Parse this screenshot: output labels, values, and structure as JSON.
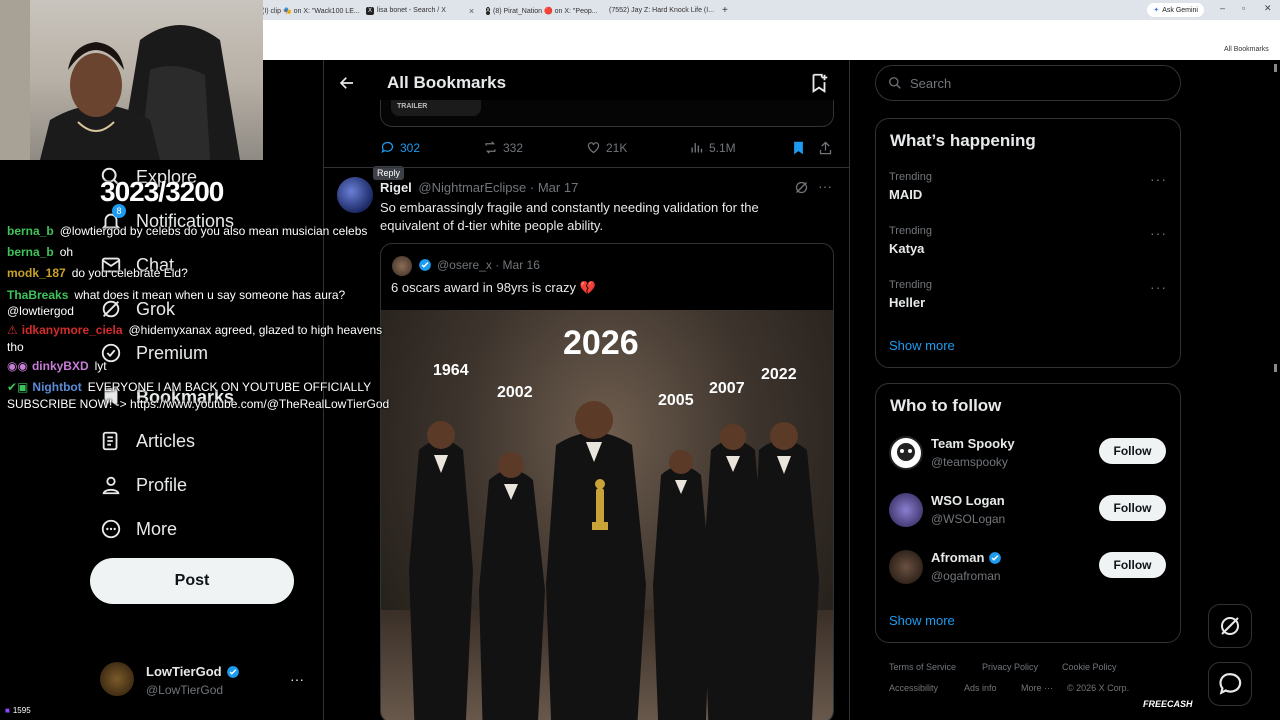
{
  "browser": {
    "tabs": [
      {
        "label": "(I) clip 🎭 on X: \"Wack100 LE..."
      },
      {
        "label": "lisa bonet - Search / X"
      },
      {
        "label": "(8) Pirat_Nation 🔴 on X: \"Peop..."
      },
      {
        "label": "(7552) Jay Z: Hard Knock Life (I..."
      }
    ],
    "new_tab": "+",
    "ask_gemini": "Ask Gemini",
    "all_bookmarks": "All Bookmarks"
  },
  "stream": {
    "counter": "3023/3200",
    "viewers": "1595",
    "watermark": "FREECASH",
    "chat": [
      {
        "user": "berna_b",
        "user_color": "#3ec35a",
        "text": "@lowtiergod by celebs do you also mean musician celebs"
      },
      {
        "user": "berna_b",
        "user_color": "#3ec35a",
        "text": "oh"
      },
      {
        "user": "modk_187",
        "user_color": "#c9a227",
        "text": "do you celebrate Eid?"
      },
      {
        "user": "ThaBreaks",
        "user_color": "#3ec35a",
        "text": "what does it mean when u say someone has aura?"
      },
      {
        "user": "",
        "user_color": "#ffffff",
        "text": "@lowtiergod"
      },
      {
        "user": "idkanymore_ciela",
        "user_color": "#d42b2b",
        "text": "@hidemyxanax agreed, glazed to high heavens"
      },
      {
        "user": "",
        "user_color": "#ffffff",
        "text": "tho"
      },
      {
        "user": "dinkyBXD",
        "user_color": "#c77dd6",
        "text": "lyt"
      },
      {
        "user": "Nightbot",
        "user_color": "#5b8bd6",
        "text": "EVERYONE I AM BACK ON YOUTUBE OFFICIALLY"
      },
      {
        "user": "",
        "user_color": "#ffffff",
        "text": "SUBSCRIBE NOW! -> https://www.youtube.com/@TheRealLowTierGod"
      }
    ]
  },
  "sidebar": {
    "items": [
      {
        "label": "Explore",
        "icon": "search-icon"
      },
      {
        "label": "Notifications",
        "icon": "bell-icon",
        "badge": "8"
      },
      {
        "label": "Chat",
        "icon": "mail-icon"
      },
      {
        "label": "Grok",
        "icon": "grok-icon"
      },
      {
        "label": "Premium",
        "icon": "premium-icon"
      },
      {
        "label": "Bookmarks",
        "icon": "bookmark-icon"
      },
      {
        "label": "Articles",
        "icon": "article-icon"
      },
      {
        "label": "Profile",
        "icon": "profile-icon"
      },
      {
        "label": "More",
        "icon": "more-icon"
      }
    ],
    "post_label": "Post",
    "account": {
      "name": "LowTierGod",
      "handle": "@LowTierGod"
    }
  },
  "header": {
    "title": "All Bookmarks"
  },
  "prev_post": {
    "trailer_label": "TRAILER",
    "replies": "302",
    "reposts": "332",
    "likes": "21K",
    "views": "5.1M",
    "tooltip": "Reply"
  },
  "post": {
    "author": "Rigel",
    "handle": "@NightmarEclipse",
    "date": "Mar 17",
    "text_line1": "So embarassingly fragile and constantly needing validation for the",
    "text_line2": "equivalent of d-tier white people ability.",
    "quote": {
      "handle": "@osere_x",
      "date": "Mar 16",
      "text": "6 oscars award in 98yrs is crazy 💔",
      "image_years": [
        "2026",
        "1964",
        "2002",
        "2005",
        "2007",
        "2022"
      ]
    }
  },
  "right": {
    "search_placeholder": "Search",
    "whats_happening": "What’s happening",
    "trends": [
      {
        "context": "Trending",
        "name": "MAID"
      },
      {
        "context": "Trending",
        "name": "Katya"
      },
      {
        "context": "Trending",
        "name": "Heller"
      }
    ],
    "show_more": "Show more",
    "who_to_follow": "Who to follow",
    "follow_suggestions": [
      {
        "name": "Team Spooky",
        "handle": "@teamspooky",
        "verified": false
      },
      {
        "name": "WSO Logan",
        "handle": "@WSOLogan",
        "verified": false
      },
      {
        "name": "Afroman",
        "handle": "@ogafroman",
        "verified": true
      }
    ],
    "follow_label": "Follow",
    "footer": [
      "Terms of Service",
      "Privacy Policy",
      "Cookie Policy",
      "Accessibility",
      "Ads info",
      "More ···",
      "© 2026 X Corp."
    ]
  },
  "colors": {
    "accent": "#1d9bf0",
    "bg": "#000000",
    "border": "#2f3336",
    "muted": "#71767b"
  }
}
